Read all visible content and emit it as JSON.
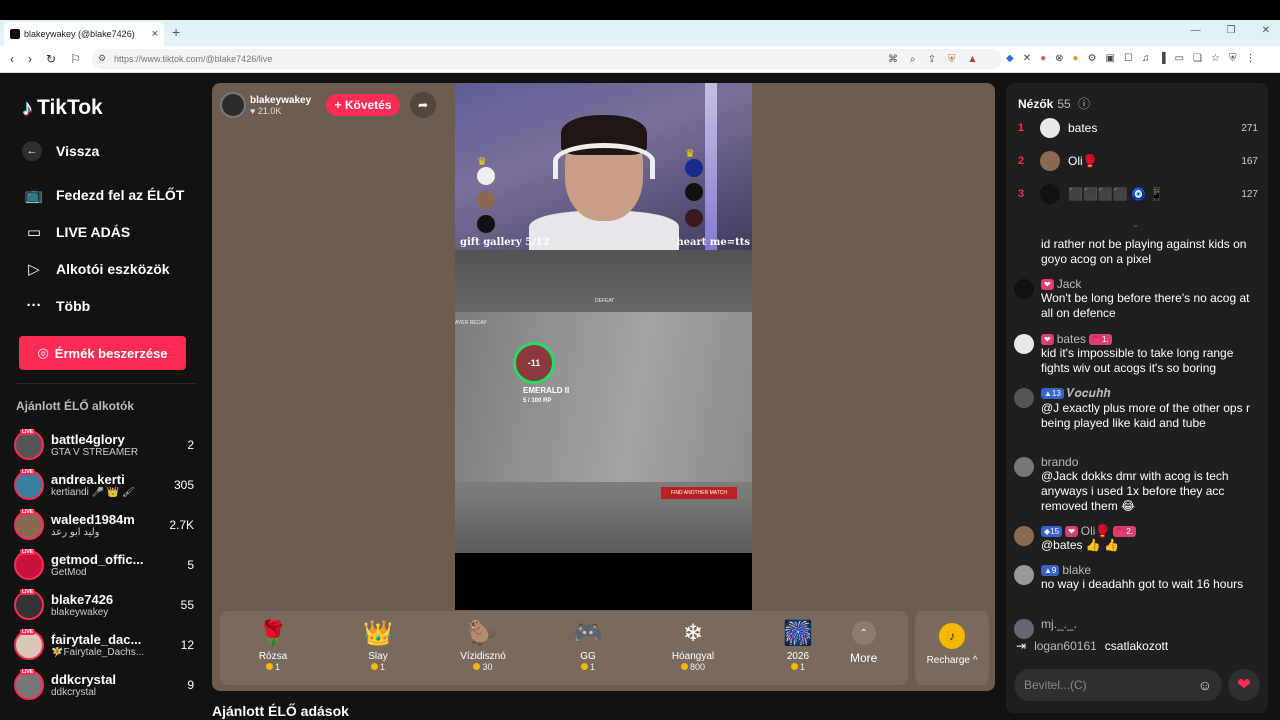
{
  "browser": {
    "tab_title": "blakeywakey⁠ (@blake7426)",
    "tab_close": "×",
    "new_tab": "+",
    "url": "https://www.tiktok.com/@blake7426/live"
  },
  "sidebar": {
    "logo": "TikTok",
    "back_label": "Vissza",
    "nav": [
      {
        "label": "Fedezd fel az ÉLŐT",
        "icon": "live-tv-icon"
      },
      {
        "label": "LIVE ADÁS",
        "icon": "camera-icon"
      },
      {
        "label": "Alkotói eszközök",
        "icon": "creator-tools-icon"
      },
      {
        "label": "Több",
        "icon": "more-dots-icon"
      }
    ],
    "coins_button": "Érmék beszerzése",
    "recommended_title": "Ajánlott ÉLŐ alkotók",
    "live_badge": "LIVE",
    "creators": [
      {
        "name": "battle4glory",
        "sub": "GTA V STREAMER",
        "count": "2"
      },
      {
        "name": "andrea.kerti",
        "sub": "kertiandi 🎤 👑 🖌",
        "count": "305"
      },
      {
        "name": "waleed1984m",
        "sub": "وليد ابو رعد",
        "count": "2.7K"
      },
      {
        "name": "getmod_offic...",
        "sub": "GetMod",
        "count": "5"
      },
      {
        "name": "blake7426",
        "sub": "blakeywakey⁠",
        "count": "55"
      },
      {
        "name": "fairytale_dac...",
        "sub": "🧚Fairytale_Dachs...",
        "count": "12"
      },
      {
        "name": "ddkcrystal",
        "sub": "ddkcrystal",
        "count": "9"
      }
    ]
  },
  "stage": {
    "host_name": "blakeywakey⁠",
    "host_likes": "21.0K",
    "follow_label": "+ Követés",
    "overlay_left": "gift gallery 5/12",
    "overlay_right": "heart me=tts",
    "rank_label": "EMERALD II",
    "rank_sub": "5 / 100 RP",
    "rank_value": "-11",
    "find_match": "FIND ANOTHER MATCH",
    "recap": "AYER RECAP",
    "defeat": "DEFEAT"
  },
  "gifts": [
    {
      "name": "Rózsa",
      "price": "1",
      "icon": "🌹"
    },
    {
      "name": "Slay",
      "price": "1",
      "icon": "👑"
    },
    {
      "name": "Vízidisznó",
      "price": "30",
      "icon": "🦫"
    },
    {
      "name": "GG",
      "price": "1",
      "icon": "🎮"
    },
    {
      "name": "Hóangyal",
      "price": "800",
      "icon": "❄"
    },
    {
      "name": "2026",
      "price": "1",
      "icon": "🎆"
    }
  ],
  "more_label": "More",
  "recharge_label": "Recharge ^",
  "recommended_live_title": "Ajánlott ÉLŐ adások",
  "chat": {
    "viewers_title": "Nézők",
    "viewers_count": "55",
    "viewers": [
      {
        "rank": "1",
        "name": "bates",
        "score": "271",
        "color": "#e8e8e8"
      },
      {
        "rank": "2",
        "name": "Oli🥊",
        "score": "167",
        "color": "#8a6a55"
      },
      {
        "rank": "3",
        "name": "⬛⬛⬛⬛ 🧿 📱",
        "score": "127",
        "color": "#111111"
      }
    ],
    "messages": [
      {
        "user": "",
        "text": "id rather not be playing against kids on goyo acog on a pixel",
        "badges": []
      },
      {
        "user": "Jack",
        "text": "Won't be long before there's no acog at all on defence",
        "badges": [
          {
            "t": "❤",
            "c": "pink"
          }
        ]
      },
      {
        "user": "bates",
        "text": "kid it's impossible to take long range fights wiv out acogs it's so boring",
        "badges": [
          {
            "t": "❤",
            "c": "pink"
          },
          {
            "t": "💗1.",
            "c": "pink"
          }
        ]
      },
      {
        "user": "𝑽𝒐𝒄𝒖𝒉𝒉",
        "text": "@J exactly plus more of the other ops r being played like kaid and tube",
        "badges": [
          {
            "t": "▲13",
            "c": "blue"
          }
        ]
      },
      {
        "user": "brando",
        "text": "@Jack dokks dmr with acog is tech anyways i used 1x before they acc removed them 😂",
        "badges": []
      },
      {
        "user": "Oli🥊",
        "text": "@bates 👍 👍",
        "badges": [
          {
            "t": "◆15",
            "c": "blue"
          },
          {
            "t": "❤",
            "c": "pink"
          },
          {
            "t": "💗2.",
            "c": "pink"
          }
        ]
      },
      {
        "user": "blake",
        "text": "no way i deadahh got to wait 16 hours",
        "badges": [
          {
            "t": "▲9",
            "c": "blue"
          }
        ]
      },
      {
        "user": "",
        "text": "mj._._.",
        "badges": []
      }
    ],
    "joined_user": "logan60161",
    "joined_text": "csatlakozott",
    "input_placeholder": "Bevitel...(C)"
  }
}
